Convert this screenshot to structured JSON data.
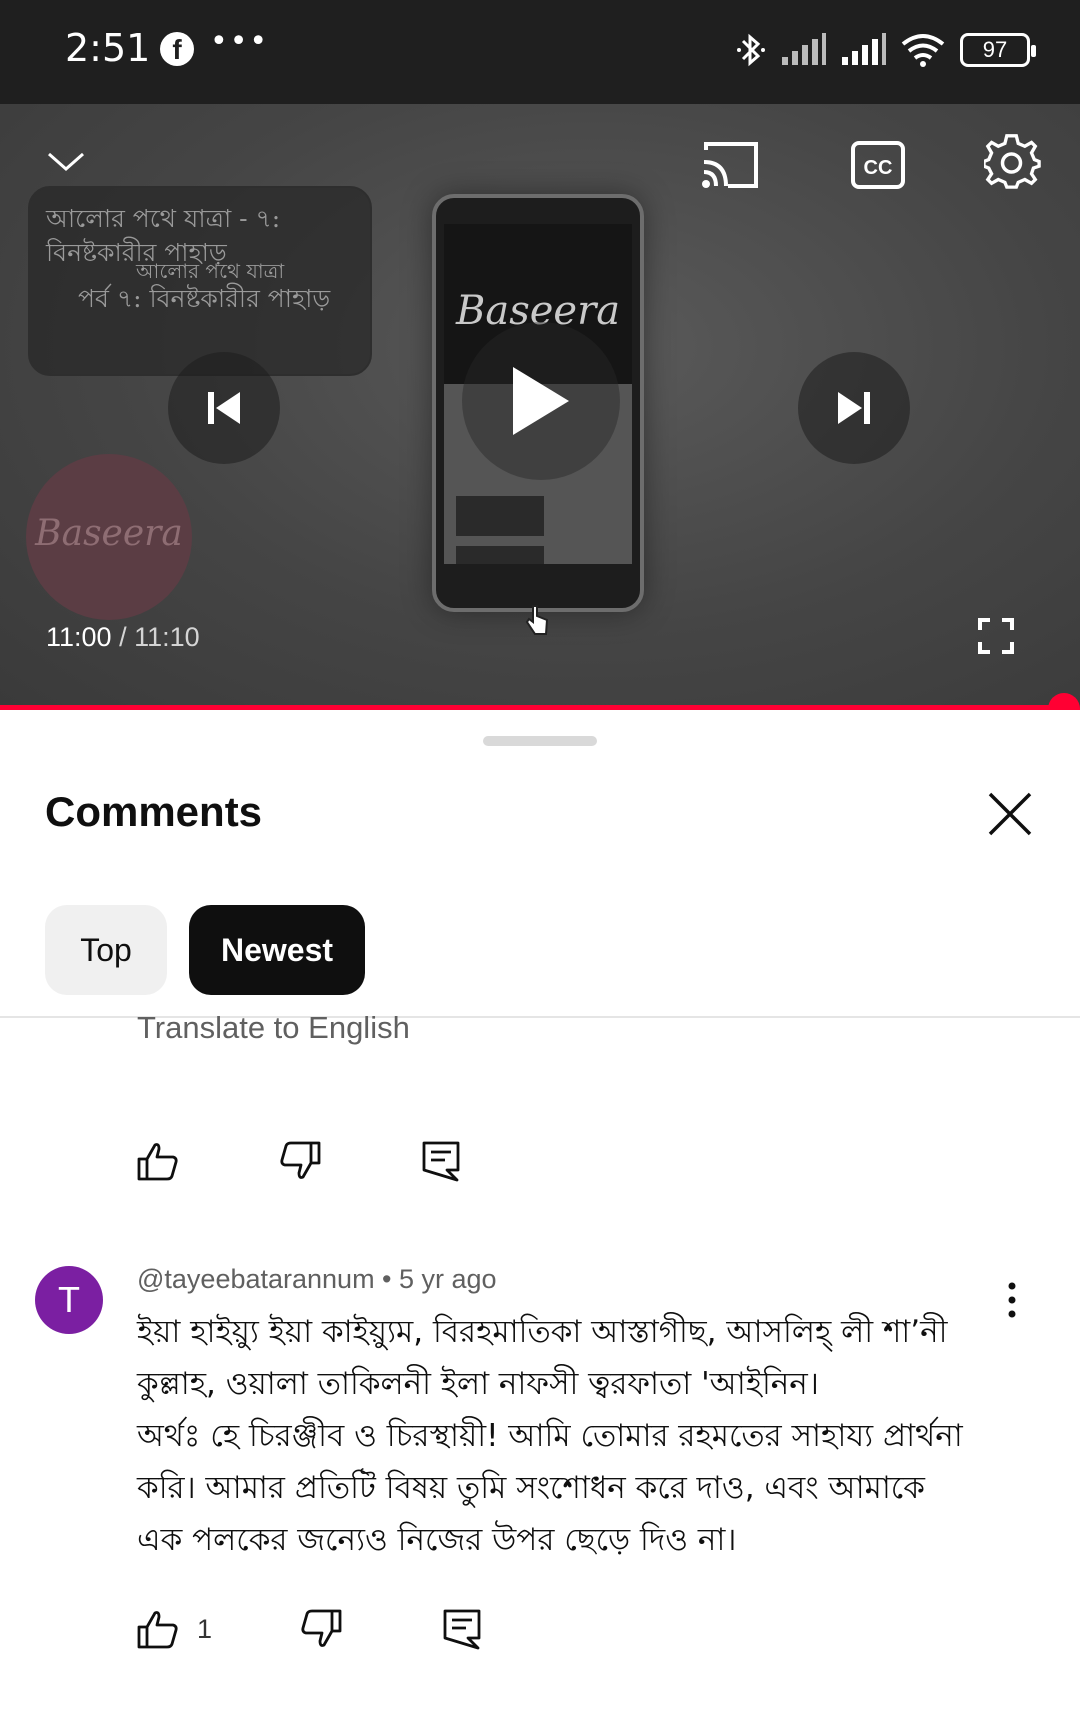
{
  "status_bar": {
    "time": "2:51",
    "notification_icons": [
      "facebook-icon",
      "more-dots-icon"
    ],
    "battery": "97",
    "system_icons": [
      "bluetooth-icon",
      "signal-icon",
      "signal-icon",
      "wifi-icon",
      "battery-icon"
    ]
  },
  "player": {
    "title_card_line1": "আলোর পথে যাত্রা - ৭:",
    "title_card_line2": "বিনষ্টকারীর পাহাড়",
    "title_card_overlay1": "আলোর পথে যাত্রা",
    "title_card_overlay2": "পর্ব ৭: বিনষ্টকারীর পাহাড়",
    "brand_logo": "Baseera",
    "current_time": "11:00",
    "separator": " / ",
    "duration": "11:10",
    "progress_fraction": 0.985,
    "accent_color": "#ff0033",
    "controls": [
      "collapse-icon",
      "cast-icon",
      "captions-icon",
      "settings-icon",
      "previous-icon",
      "play-icon",
      "next-icon",
      "fullscreen-icon"
    ]
  },
  "comments": {
    "title": "Comments",
    "filters": [
      {
        "label": "Top",
        "selected": false
      },
      {
        "label": "Newest",
        "selected": true
      }
    ],
    "partial_comment": {
      "translate_label": "Translate to English"
    },
    "comment": {
      "avatar_letter": "T",
      "avatar_color": "#7b1fa2",
      "author": "@tayeebatarannum",
      "age": "5 yr ago",
      "meta": "@tayeebatarannum • 5 yr ago",
      "lines": [
        "ইয়া হাইয়্যু ইয়া কাইয়্যুম, বিরহমাতিকা আস্তাগীছ,  আসলিহ্ লী শা’নী",
        "কুল্লাহ, ওয়ালা তাকিলনী ইলা নাফসী ত্বরফাতা 'আইনিন।",
        "অর্থঃ হে চিরঞ্জীব ও চিরস্থায়ী! আমি তোমার রহমতের সাহায্য প্রার্থনা",
        "করি। আমার প্রতিটি বিষয় তুমি সংশোধন করে দাও, এবং আমাকে",
        "এক পলকের জন্যেও নিজের উপর ছেড়ে দিও না।"
      ],
      "like_count": "1"
    }
  }
}
